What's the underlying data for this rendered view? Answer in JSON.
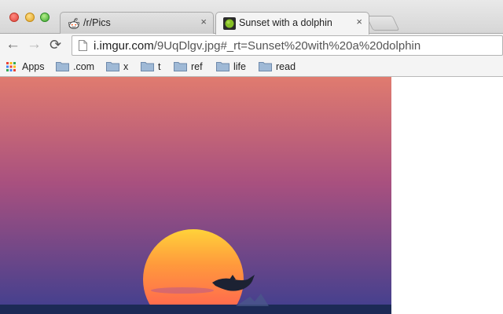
{
  "window": {
    "traffic_lights": [
      "close",
      "minimize",
      "zoom"
    ]
  },
  "tabs": [
    {
      "title": "/r/Pics",
      "close": "×",
      "favicon": "reddit-alien",
      "active": false
    },
    {
      "title": "Sunset with a dolphin",
      "close": "×",
      "favicon": "green-dot",
      "active": true
    }
  ],
  "toolbar": {
    "back_glyph": "←",
    "forward_glyph": "→",
    "reload_glyph": "⟳"
  },
  "address": {
    "domain": "i.imgur.com",
    "path": "/9UqDlgv.jpg#_rt=Sunset%20with%20a%20dolphin"
  },
  "bookmarks": {
    "apps_label": "Apps",
    "folders": [
      ".com",
      "x",
      "t",
      "ref",
      "life",
      "read"
    ]
  },
  "image": {
    "subject": "sunset with a dolphin silhouette",
    "sky_top": "#e07b6f",
    "sky_mid": "#a8507f",
    "sky_bottom": "#3f3f8f",
    "sun_top": "#ffd23a",
    "sun_bottom": "#ff4f58",
    "sea": "#1c2a56"
  }
}
